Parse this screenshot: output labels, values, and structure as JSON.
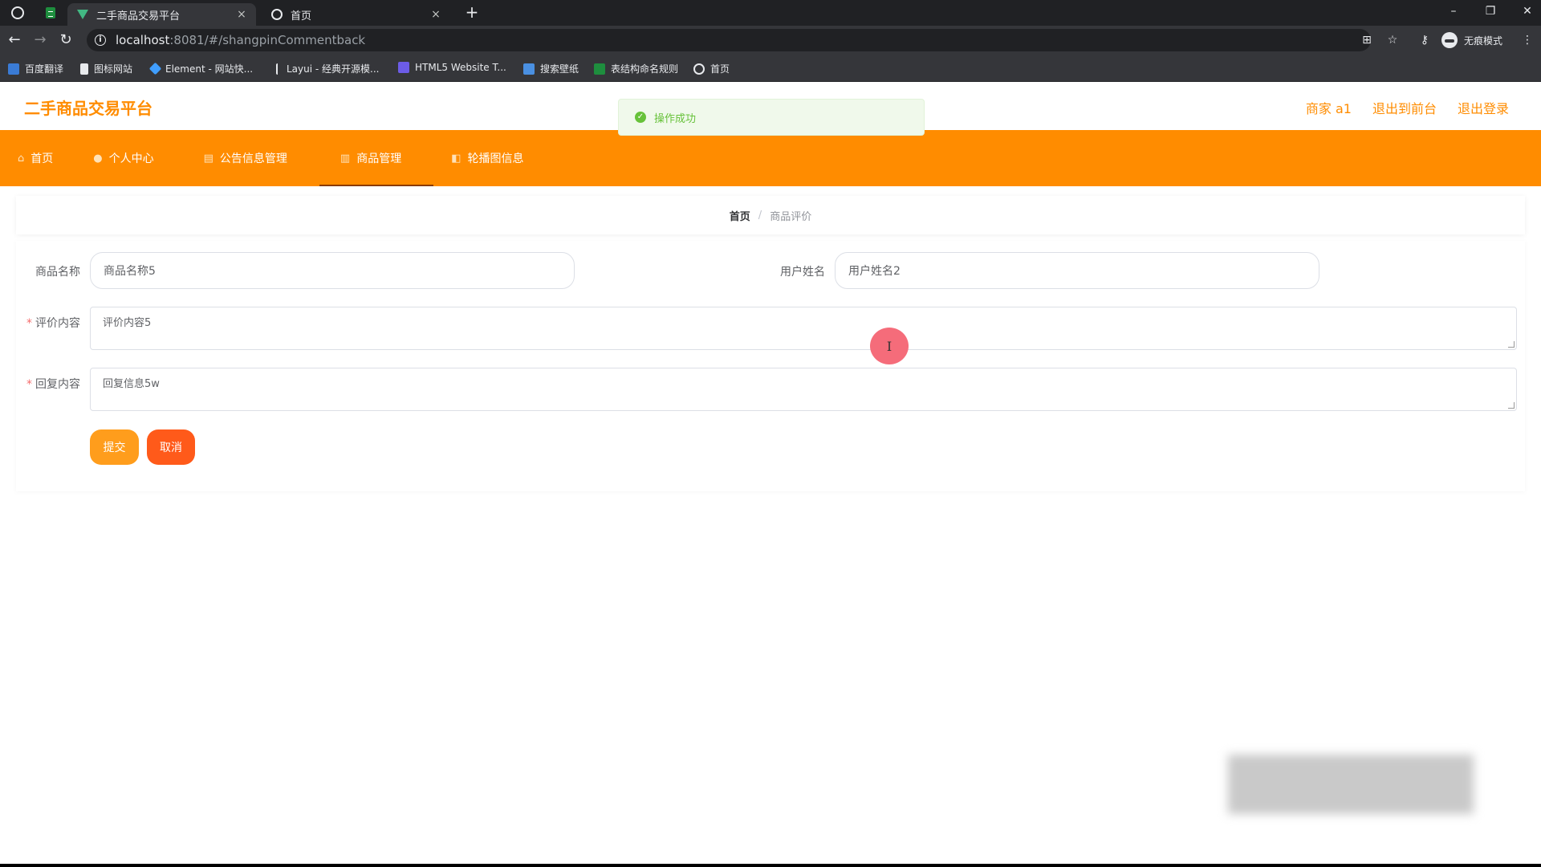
{
  "browser": {
    "tabs": [
      {
        "title": "二手商品交易平台",
        "close": "×"
      },
      {
        "title": "首页",
        "close": "×"
      }
    ],
    "new_tab": "+",
    "window_controls": [
      "–",
      "❐",
      "✕"
    ],
    "url_host": "localhost",
    "url_rest": ":8081/#/shangpinCommentback",
    "incognito_label": "无痕模式",
    "bookmarks": [
      {
        "label": "百度翻译",
        "icon": "translate-icon",
        "color": "#3a7bd5"
      },
      {
        "label": "图标网站",
        "icon": "flag-icon",
        "color": "#e8eaed"
      },
      {
        "label": "Element - 网站快...",
        "icon": "element-icon",
        "color": "#409eff"
      },
      {
        "label": "Layui - 经典开源模...",
        "icon": "layui-icon",
        "color": "#e8eaed"
      },
      {
        "label": "HTML5 Website T...",
        "icon": "html5-icon",
        "color": "#6c5ce7"
      },
      {
        "label": "搜索壁纸",
        "icon": "wallpaper-icon",
        "color": "#4a90e2"
      },
      {
        "label": "表结构命名规则",
        "icon": "sheet-icon",
        "color": "#1e8e3e"
      },
      {
        "label": "首页",
        "icon": "globe-icon",
        "color": "#e8eaed"
      }
    ]
  },
  "app": {
    "brand": "二手商品交易平台",
    "header_links": [
      "商家 a1",
      "退出到前台",
      "退出登录"
    ],
    "toast": "操作成功",
    "menu": [
      {
        "label": "首页",
        "icon": "home-icon",
        "glyph": "⌂",
        "active": false
      },
      {
        "label": "个人中心",
        "icon": "user-icon",
        "glyph": "●",
        "active": false
      },
      {
        "label": "公告信息管理",
        "icon": "notice-icon",
        "glyph": "▤",
        "active": false
      },
      {
        "label": "商品管理",
        "icon": "goods-icon",
        "glyph": "▥",
        "active": true
      },
      {
        "label": "轮播图信息",
        "icon": "carousel-icon",
        "glyph": "◧",
        "active": false
      }
    ],
    "breadcrumb": {
      "home": "首页",
      "sep": "/",
      "current": "商品评价"
    },
    "form": {
      "product_name_label": "商品名称",
      "product_name_value": "商品名称5",
      "user_name_label": "用户姓名",
      "user_name_value": "用户姓名2",
      "review_label": "评价内容",
      "review_value": "评价内容5",
      "reply_label": "回复内容",
      "reply_value": "回复信息5w",
      "required_mark": "*",
      "submit": "提交",
      "cancel": "取消"
    },
    "cursor_glyph": "I",
    "colors": {
      "accent": "#ff8c00",
      "submit": "#ff9d1c",
      "cancel": "#ff5a1a",
      "success": "#67c23a"
    }
  }
}
